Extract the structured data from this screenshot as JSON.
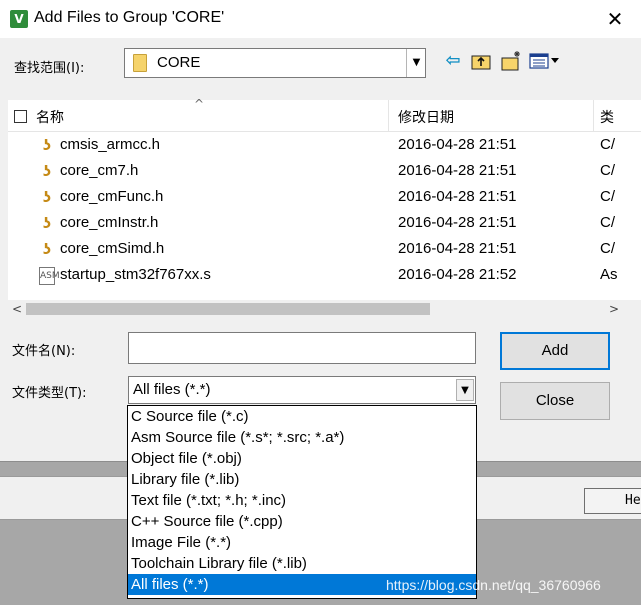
{
  "window": {
    "title": "Add Files to Group 'CORE'",
    "app_icon": "V",
    "close_glyph": "✕"
  },
  "lookin": {
    "label": "查找范围(I):",
    "value": "CORE",
    "dropdown_glyph": "▼"
  },
  "toolbar": {
    "back_glyph": "⇦",
    "up_glyph": "⬑",
    "newfolder_glyph": "✦",
    "views_glyph": "☷▾"
  },
  "list": {
    "columns": {
      "name": "名称",
      "date": "修改日期",
      "type": "类"
    },
    "sort_glyph": "^",
    "files": [
      {
        "icon": "h-file-icon",
        "glyph": "ʖ",
        "name": "cmsis_armcc.h",
        "date": "2016-04-28 21:51",
        "type": "C/"
      },
      {
        "icon": "h-file-icon",
        "glyph": "ʖ",
        "name": "core_cm7.h",
        "date": "2016-04-28 21:51",
        "type": "C/"
      },
      {
        "icon": "h-file-icon",
        "glyph": "ʖ",
        "name": "core_cmFunc.h",
        "date": "2016-04-28 21:51",
        "type": "C/"
      },
      {
        "icon": "h-file-icon",
        "glyph": "ʖ",
        "name": "core_cmInstr.h",
        "date": "2016-04-28 21:51",
        "type": "C/"
      },
      {
        "icon": "h-file-icon",
        "glyph": "ʖ",
        "name": "core_cmSimd.h",
        "date": "2016-04-28 21:51",
        "type": "C/"
      },
      {
        "icon": "asm-file-icon",
        "glyph": "ASM",
        "name": "startup_stm32f767xx.s",
        "date": "2016-04-28 21:52",
        "type": "As"
      }
    ]
  },
  "scroll": {
    "left_glyph": "<",
    "right_glyph": ">"
  },
  "filename": {
    "label": "文件名(N):",
    "value": ""
  },
  "filetype": {
    "label": "文件类型(T):",
    "selected": "All files (*.*)",
    "dropdown_glyph": "▼",
    "options": [
      "C Source file (*.c)",
      "Asm Source file (*.s*; *.src; *.a*)",
      "Object file (*.obj)",
      "Library file (*.lib)",
      "Text file (*.txt; *.h; *.inc)",
      "C++ Source file (*.cpp)",
      "Image File (*.*)",
      "Toolchain Library file (*.lib)",
      "All files (*.*)"
    ],
    "selected_index": 8
  },
  "buttons": {
    "add": "Add",
    "close": "Close"
  },
  "background": {
    "help_label": "He"
  },
  "watermark": "https://blog.csdn.net/qq_36760966",
  "colors": {
    "selection": "#0078d7",
    "default_button_border": "#0078d7"
  }
}
